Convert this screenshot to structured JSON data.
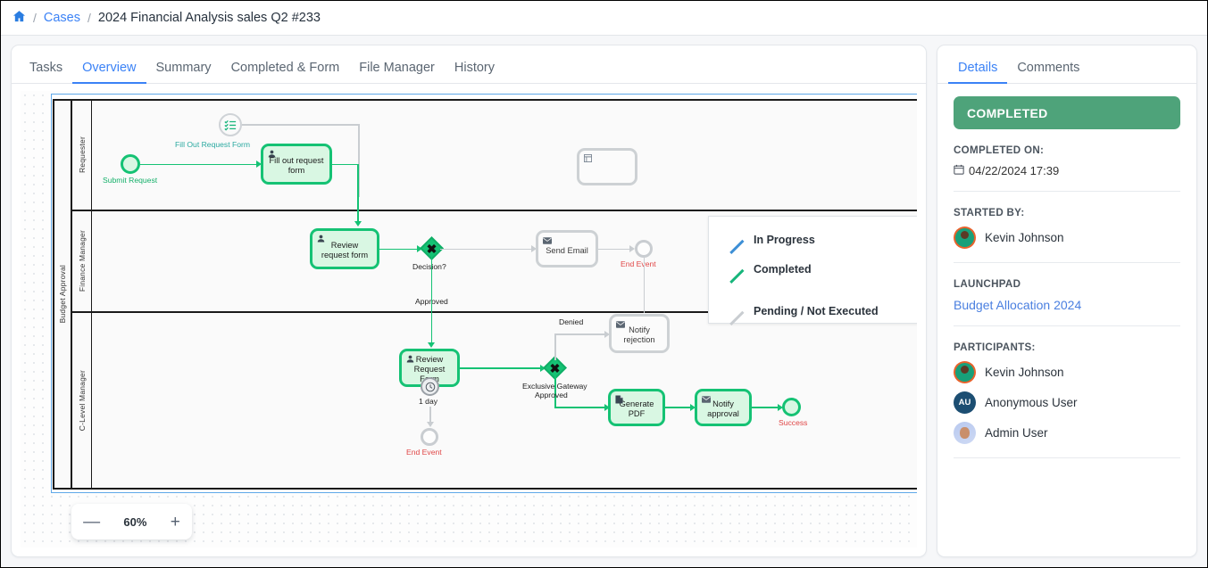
{
  "breadcrumb": {
    "home_icon": "home-icon",
    "sep": "/",
    "link": "Cases",
    "current": "2024 Financial Analysis sales Q2 #233"
  },
  "main": {
    "tabs": [
      {
        "label": "Tasks",
        "active": false
      },
      {
        "label": "Overview",
        "active": true
      },
      {
        "label": "Summary",
        "active": false
      },
      {
        "label": "Completed & Form",
        "active": false
      },
      {
        "label": "File Manager",
        "active": false
      },
      {
        "label": "History",
        "active": false
      }
    ],
    "zoom": {
      "minus": "—",
      "value": "60%",
      "plus": "+"
    }
  },
  "legend": {
    "items": [
      {
        "label": "In Progress",
        "color": "#3d8fd6"
      },
      {
        "label": "Completed",
        "color": "#17b57b"
      },
      {
        "label": "Pending / Not Executed",
        "color": "#c9cdd1"
      }
    ]
  },
  "diagram": {
    "pool": "Budget Approval",
    "lanes": [
      "Requester",
      "Finance Manager",
      "C-Level Manager"
    ],
    "nodes": {
      "annotation_form": "Fill Out Request Form",
      "start_event": "Submit Request",
      "fill_out_task": "Fill out request form",
      "review_request_form_task": "Review request form",
      "decision_gateway": "Decision?",
      "decision_approved_label": "Approved",
      "send_email_task": "Send Email",
      "end_event_top": "End Event",
      "review_request_form_clevel": "Review Request Form",
      "timer_label": "1 day",
      "end_event_timer": "End Event",
      "exclusive_gateway": "Exclusive Gateway",
      "denied_label": "Denied",
      "approved_label": "Approved",
      "notify_rejection_task": "Notify rejection",
      "generate_pdf_task": "Generate PDF",
      "notify_approval_task": "Notify approval",
      "success_event": "Success"
    }
  },
  "side": {
    "tabs": [
      {
        "label": "Details",
        "active": true
      },
      {
        "label": "Comments",
        "active": false
      }
    ],
    "status": "COMPLETED",
    "completed_on_label": "COMPLETED ON:",
    "completed_on_value": "04/22/2024 17:39",
    "started_by_label": "STARTED BY:",
    "started_by_name": "Kevin Johnson",
    "launchpad_label": "LAUNCHPAD",
    "launchpad_link": "Budget Allocation 2024",
    "participants_label": "PARTICIPANTS:",
    "participants": [
      {
        "name": "Kevin Johnson",
        "initials": ""
      },
      {
        "name": "Anonymous User",
        "initials": "AU"
      },
      {
        "name": "Admin User",
        "initials": ""
      }
    ]
  },
  "colors": {
    "accent_blue": "#3b82f6",
    "status_green": "#4ea37a",
    "bpmn_green": "#15c274",
    "bpmn_gray": "#c9cdd1",
    "red_label": "#e04646"
  }
}
